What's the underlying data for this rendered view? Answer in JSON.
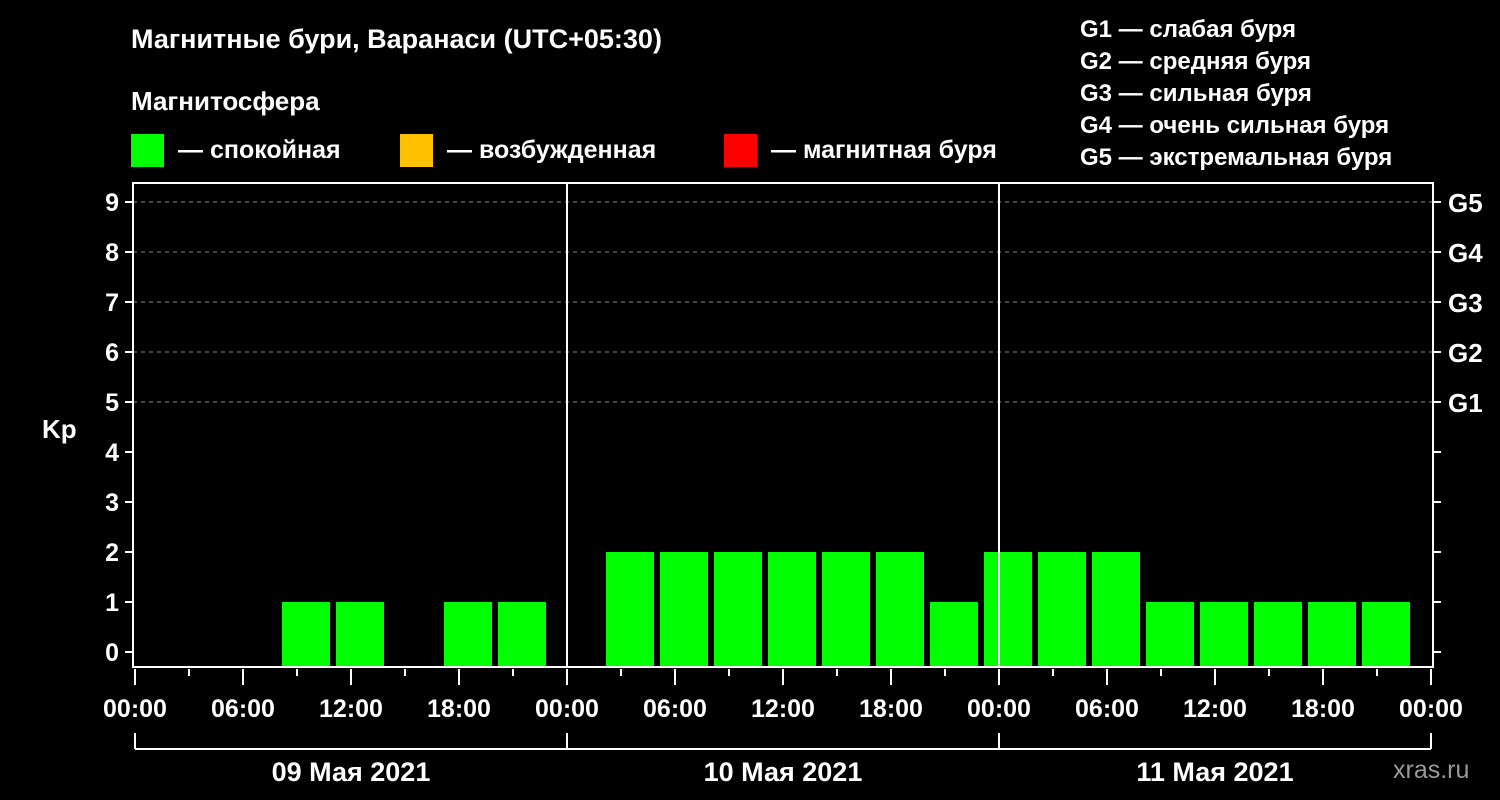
{
  "header": {
    "title": "Магнитные бури, Варанаси (UTC+05:30)",
    "subtitle": "Магнитосфера",
    "legend": [
      {
        "label": "— спокойная",
        "color": "#00ff00"
      },
      {
        "label": "— возбужденная",
        "color": "#ffc000"
      },
      {
        "label": "— магнитная буря",
        "color": "#ff0000"
      }
    ],
    "g_scale": [
      "G1 — слабая буря",
      "G2 — средняя буря",
      "G3 — сильная буря",
      "G4 — очень сильная буря",
      "G5 — экстремальная буря"
    ]
  },
  "watermark": "xras.ru",
  "chart_data": {
    "type": "bar",
    "ylabel": "Kp",
    "ylim": [
      0,
      9
    ],
    "yticks": [
      "0",
      "1",
      "2",
      "3",
      "4",
      "5",
      "6",
      "7",
      "8",
      "9"
    ],
    "right_ticks": [
      {
        "kp": 5,
        "label": "G1"
      },
      {
        "kp": 6,
        "label": "G2"
      },
      {
        "kp": 7,
        "label": "G3"
      },
      {
        "kp": 8,
        "label": "G4"
      },
      {
        "kp": 9,
        "label": "G5"
      }
    ],
    "xlim_hours": [
      0,
      72
    ],
    "xtick_labels": [
      "00:00",
      "06:00",
      "12:00",
      "18:00",
      "00:00",
      "06:00",
      "12:00",
      "18:00",
      "00:00",
      "06:00",
      "12:00",
      "18:00",
      "00:00"
    ],
    "days": [
      "09 Мая 2021",
      "10 Мая 2021",
      "11 Мая 2021"
    ],
    "bar_center_hours": [
      0.5,
      3.5,
      6.5,
      9.5,
      12.5,
      15.5,
      18.5,
      21.5,
      24.5,
      27.5,
      30.5,
      33.5,
      36.5,
      39.5,
      42.5,
      45.5,
      48.5,
      51.5,
      54.5,
      57.5,
      60.5,
      63.5,
      66.5,
      69.5
    ],
    "values": [
      0,
      0,
      0,
      1,
      1,
      0,
      1,
      1,
      0,
      2,
      2,
      2,
      2,
      2,
      2,
      1,
      2,
      2,
      2,
      1,
      1,
      1,
      1,
      1
    ],
    "colors": {
      "quiet": "#00ff00",
      "active": "#ffc000",
      "storm": "#ff0000"
    },
    "grid": true
  }
}
